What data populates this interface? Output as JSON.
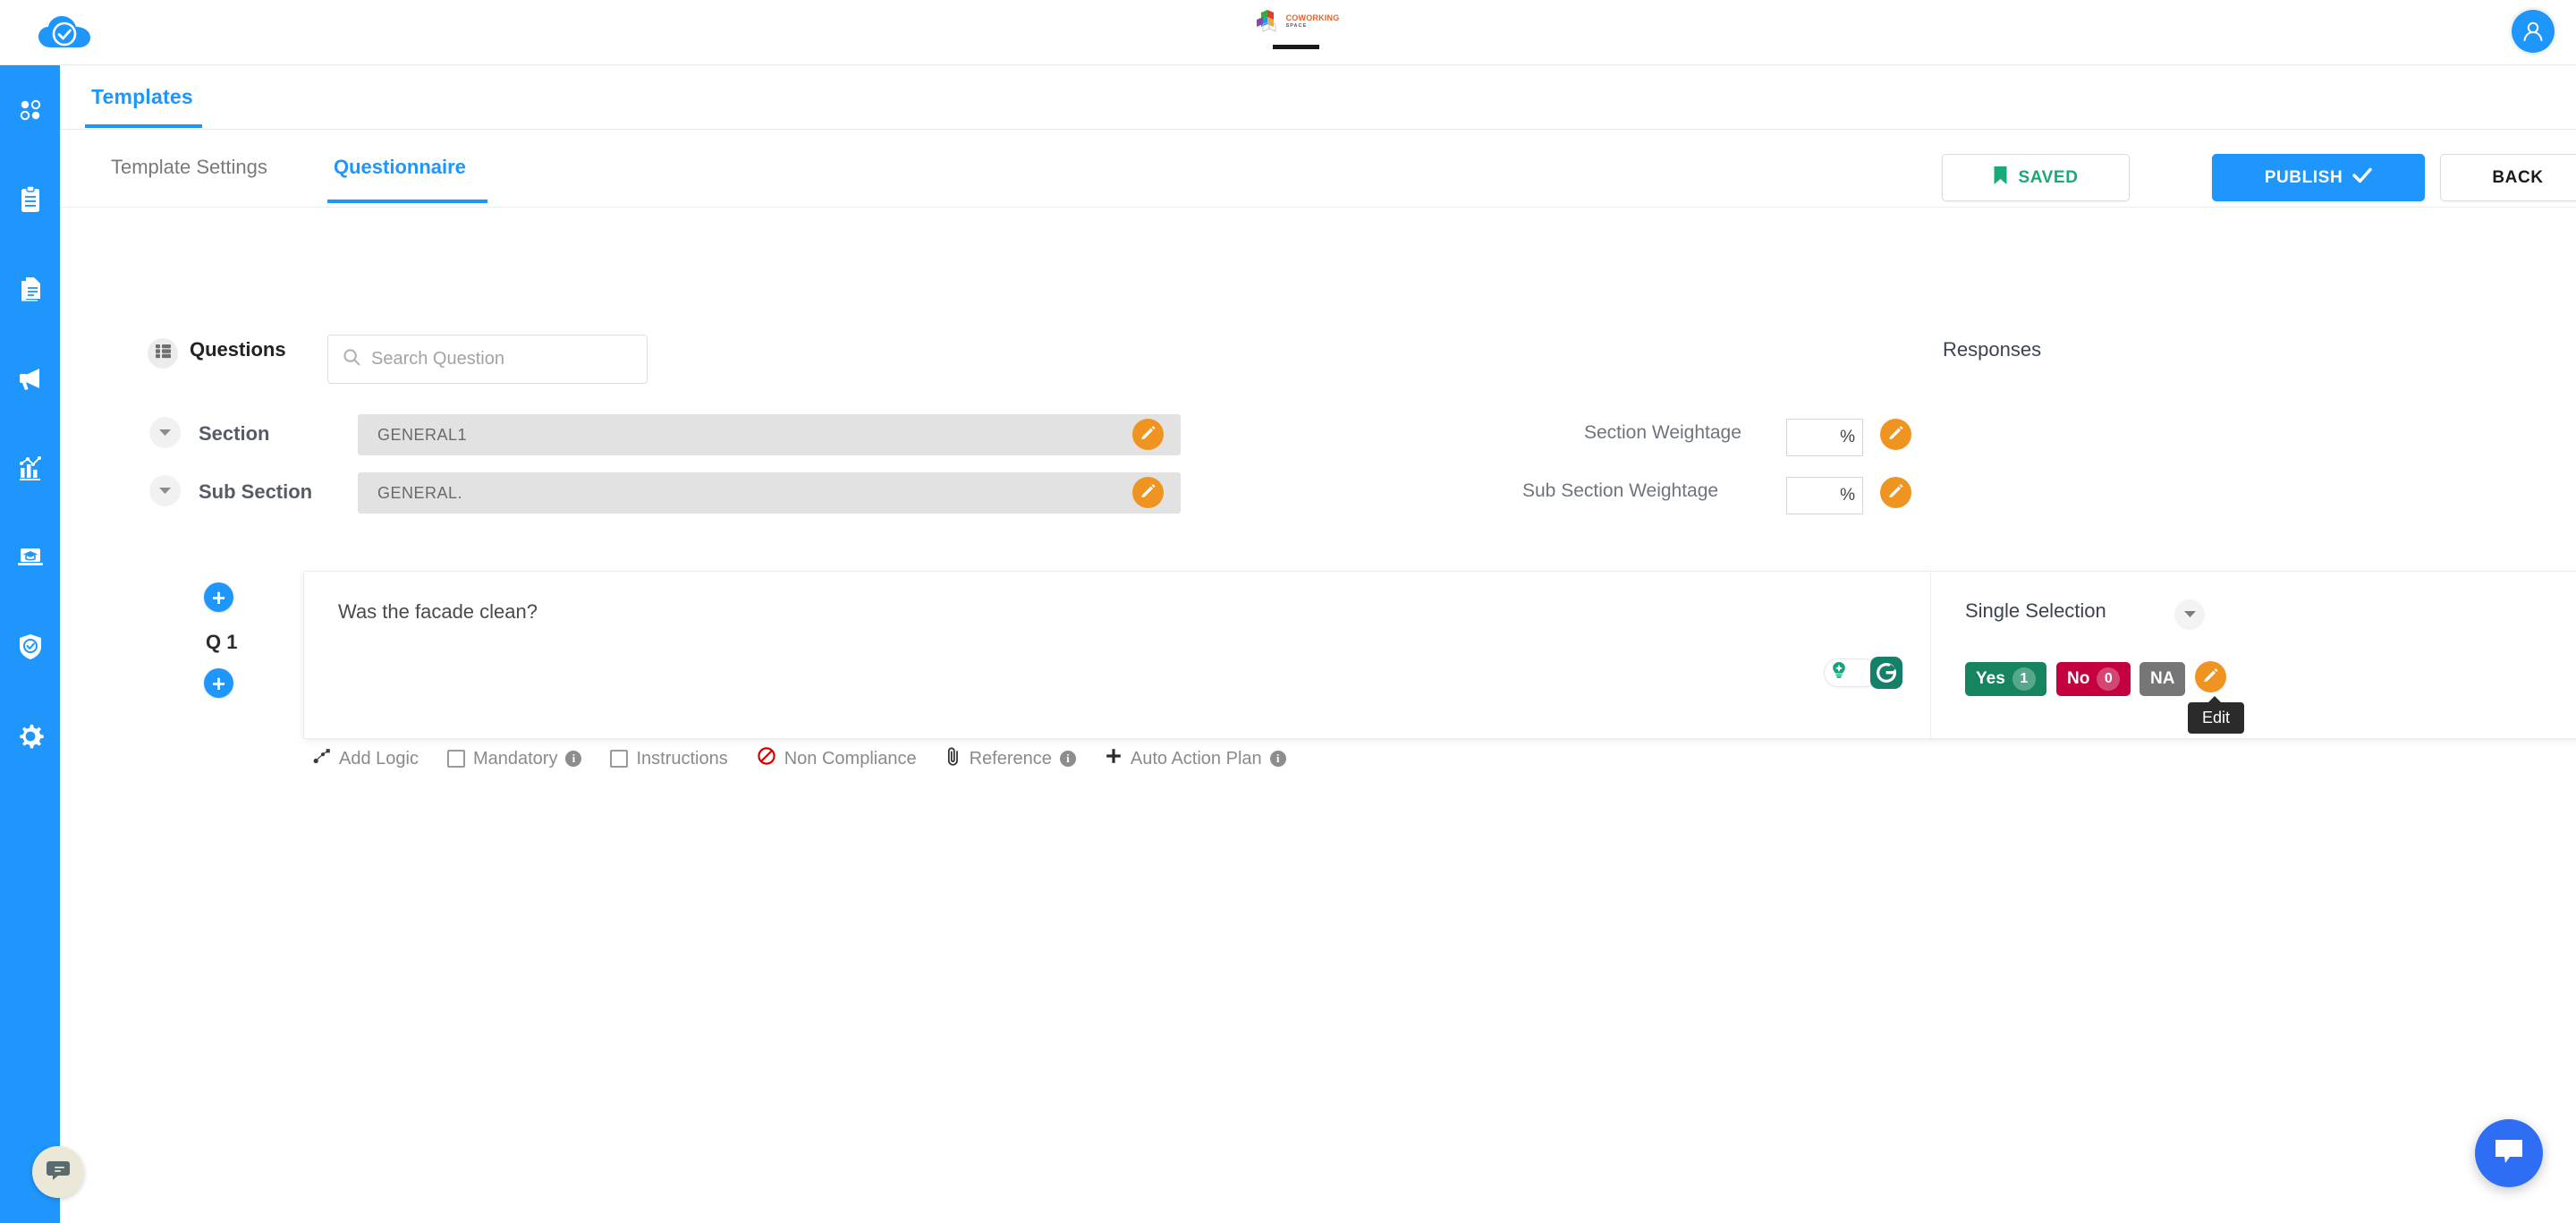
{
  "app": {
    "logo_icon": "cloud-check-logo",
    "center_brand": "COWORKING",
    "center_brand_sub": "SPACE",
    "avatar_icon": "user-avatar-icon"
  },
  "rail": {
    "items": [
      {
        "icon": "dashboard-dots-icon",
        "name": "dashboard"
      },
      {
        "icon": "clipboard-icon",
        "name": "audits"
      },
      {
        "icon": "documents-icon",
        "name": "templates"
      },
      {
        "icon": "megaphone-icon",
        "name": "announcements"
      },
      {
        "icon": "analytics-chart-icon",
        "name": "analytics"
      },
      {
        "icon": "elearning-laptop-icon",
        "name": "elearning"
      },
      {
        "icon": "shield-check-icon",
        "name": "compliance"
      },
      {
        "icon": "gear-icon",
        "name": "settings"
      }
    ],
    "chat_icon": "chat-bubble-icon"
  },
  "main_tab": {
    "label": "Templates"
  },
  "subtabs": [
    {
      "label": "Template Settings",
      "active": false
    },
    {
      "label": "Questionnaire",
      "active": true
    }
  ],
  "actions": {
    "saved_label": "SAVED",
    "saved_icon": "bookmark-icon",
    "publish_label": "PUBLISH",
    "publish_icon": "check-icon",
    "back_label": "BACK"
  },
  "questions_panel": {
    "icon": "list-icon",
    "title": "Questions",
    "search_placeholder": "Search Question",
    "search_value": "",
    "search_icon": "search-icon"
  },
  "responses_panel": {
    "title": "Responses"
  },
  "section": {
    "caret_icon": "chevron-down-icon",
    "label": "Section",
    "value": "GENERAL1",
    "edit_icon": "pencil-icon",
    "weightage_label": "Section Weightage",
    "weightage_value": "",
    "weightage_suffix": "%"
  },
  "subsection": {
    "caret_icon": "chevron-down-icon",
    "label": "Sub Section",
    "value": "GENERAL.",
    "edit_icon": "pencil-icon",
    "weightage_label": "Sub Section Weightage",
    "weightage_value": "",
    "weightage_suffix": "%"
  },
  "question": {
    "number": "Q 1",
    "text": "Was the facade clean?",
    "add_above_icon": "plus-icon",
    "add_below_icon": "plus-icon",
    "grammarly_bulb_icon": "grammarly-bulb-icon",
    "grammarly_logo_icon": "grammarly-g-icon",
    "response_type": "Single Selection",
    "response_type_caret": "chevron-down-icon",
    "options": [
      {
        "label": "Yes",
        "score": "1",
        "color": "#16855f"
      },
      {
        "label": "No",
        "score": "0",
        "color": "#c5003e"
      },
      {
        "label": "NA",
        "score": "",
        "color": "#767676"
      }
    ],
    "edit_icon": "pencil-icon",
    "tooltip": "Edit"
  },
  "question_options_row": [
    {
      "label": "Add Logic",
      "icon": "logic-icon",
      "checkbox": false,
      "info": false
    },
    {
      "label": "Mandatory",
      "icon": "",
      "checkbox": true,
      "info": true
    },
    {
      "label": "Instructions",
      "icon": "",
      "checkbox": true,
      "info": false
    },
    {
      "label": "Non Compliance",
      "icon": "prohibition-icon",
      "checkbox": false,
      "info": false
    },
    {
      "label": "Reference",
      "icon": "paperclip-icon",
      "checkbox": false,
      "info": true
    },
    {
      "label": "Auto Action Plan",
      "icon": "plus-sign-icon",
      "checkbox": false,
      "info": true
    }
  ],
  "chat_fab": {
    "icon": "chat-bubble-icon"
  },
  "colors": {
    "brand_blue": "#1e96fc",
    "orange": "#ef9420",
    "green": "#16855f",
    "red": "#c5003e",
    "gray": "#767676"
  }
}
